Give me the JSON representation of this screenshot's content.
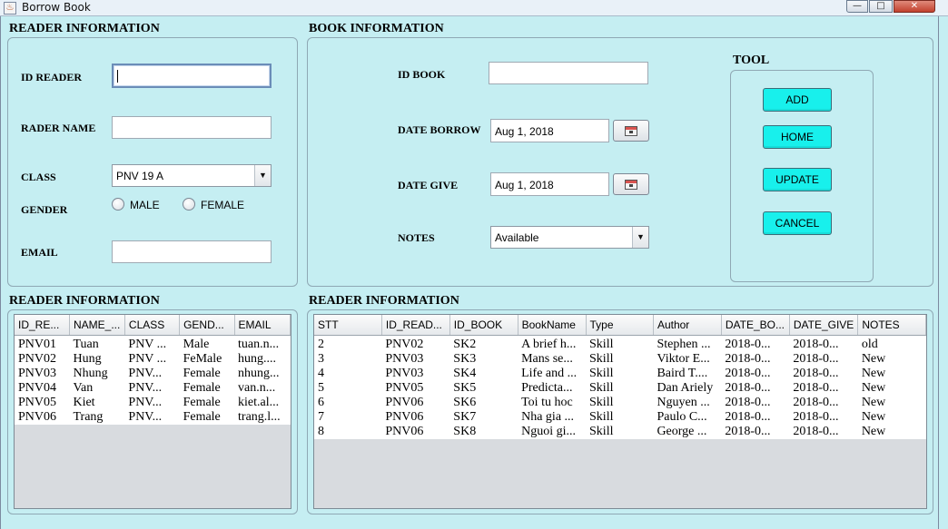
{
  "window": {
    "title": "Borrow Book",
    "minimize_glyph": "—",
    "maximize_glyph": "□",
    "close_glyph": "✕",
    "app_icon_glyph": "♨"
  },
  "reader_panel": {
    "title": "READER INFORMATION",
    "id_label": "ID READER",
    "id_value": "",
    "name_label": "RADER NAME",
    "name_value": "",
    "class_label": "CLASS",
    "class_selected": "PNV 19 A",
    "gender_label": "GENDER",
    "gender_male": "MALE",
    "gender_female": "FEMALE",
    "email_label": "EMAIL",
    "email_value": ""
  },
  "book_panel": {
    "title": "BOOK  INFORMATION",
    "id_label": "ID BOOK",
    "id_value": "",
    "date_borrow_label": "DATE BORROW",
    "date_borrow_value": "Aug 1, 2018",
    "date_give_label": "DATE GIVE",
    "date_give_value": "Aug 1, 2018",
    "notes_label": "NOTES",
    "notes_selected": "Available"
  },
  "tool_panel": {
    "title": "TOOL",
    "add": "ADD",
    "home": "HOME",
    "update": "UPDATE",
    "cancel": "CANCEL"
  },
  "readers_table": {
    "title": "READER INFORMATION",
    "columns": [
      "ID_RE...",
      "NAME_...",
      "CLASS",
      "GEND...",
      "EMAIL"
    ],
    "rows": [
      [
        "PNV01",
        "Tuan",
        "PNV ...",
        "Male",
        "tuan.n..."
      ],
      [
        "PNV02",
        "Hung",
        "PNV ...",
        "FeMale",
        "hung...."
      ],
      [
        "PNV03",
        "Nhung",
        "PNV...",
        "Female",
        "nhung..."
      ],
      [
        "PNV04",
        "Van",
        "PNV...",
        "Female",
        "van.n..."
      ],
      [
        "PNV05",
        "Kiet",
        "PNV...",
        "Female",
        "kiet.al..."
      ],
      [
        "PNV06",
        "Trang",
        "PNV...",
        "Female",
        "trang.l..."
      ]
    ]
  },
  "borrow_table": {
    "title": "READER INFORMATION",
    "columns": [
      "STT",
      "ID_READ...",
      "ID_BOOK",
      "BookName",
      "Type",
      "Author",
      "DATE_BO...",
      "DATE_GIVE",
      "NOTES"
    ],
    "rows": [
      [
        "2",
        "PNV02",
        "SK2",
        "A brief h...",
        "Skill",
        "Stephen ...",
        "2018-0...",
        "2018-0...",
        "old"
      ],
      [
        "3",
        "PNV03",
        "SK3",
        "Mans se...",
        "Skill",
        "Viktor E...",
        "2018-0...",
        "2018-0...",
        "New"
      ],
      [
        "4",
        "PNV03",
        "SK4",
        "Life and ...",
        "Skill",
        "Baird T....",
        "2018-0...",
        "2018-0...",
        "New"
      ],
      [
        "5",
        "PNV05",
        "SK5",
        "Predicta...",
        "Skill",
        "Dan Ariely",
        "2018-0...",
        "2018-0...",
        "New"
      ],
      [
        "6",
        "PNV06",
        "SK6",
        "Toi tu hoc",
        "Skill",
        "Nguyen ...",
        "2018-0...",
        "2018-0...",
        "New"
      ],
      [
        "7",
        "PNV06",
        "SK7",
        "Nha gia ...",
        "Skill",
        "Paulo C...",
        "2018-0...",
        "2018-0...",
        "New"
      ],
      [
        "8",
        "PNV06",
        "SK8",
        "Nguoi gi...",
        "Skill",
        "George ...",
        "2018-0...",
        "2018-0...",
        "New"
      ]
    ]
  }
}
